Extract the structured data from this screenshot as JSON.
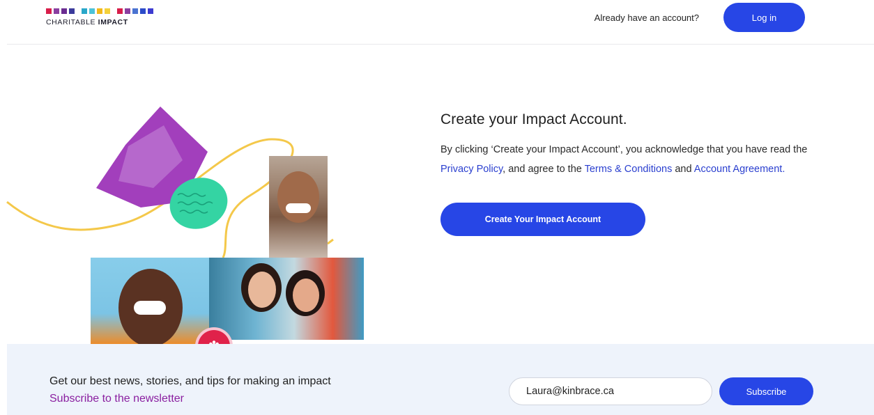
{
  "header": {
    "logo_text_plain": "CHARITABLE ",
    "logo_text_bold": "IMPACT",
    "logo_colors": [
      "#d81e4a",
      "#8a3fa0",
      "#6a2c91",
      "#3b3b9b",
      "#2aa7c9",
      "#4cc3d9",
      "#f2b81a",
      "#f4d13a",
      "#d81e4a",
      "#8a3fa0",
      "#4a73d1",
      "#2c4bc9",
      "#3d3bd0"
    ],
    "already_text": "Already have an account?",
    "login_label": "Log in"
  },
  "main": {
    "title": "Create your Impact Account.",
    "desc_part1": "By clicking ‘Create your Impact Account’, you acknowledge that you have read the ",
    "privacy_link": "Privacy Policy",
    "desc_part2": ", and agree to the ",
    "terms_link": "Terms & Conditions",
    "desc_part3": " and ",
    "agreement_link": "Account Agreement.",
    "create_label": "Create Your Impact Account"
  },
  "illustration": {
    "badge_icon": "maple-leaf-icon",
    "colors": {
      "purple": "#a23fbc",
      "green": "#34d4a3",
      "yellow": "#f4c84a"
    }
  },
  "newsletter": {
    "text": "Get our best news, stories, and tips for making an impact",
    "link": "Subscribe to the newsletter",
    "email_value": "Laura@kinbrace.ca",
    "subscribe_label": "Subscribe"
  },
  "colors": {
    "accent": "#2746e6",
    "link": "#2a3fcf",
    "newsletter_link": "#8a1fa0",
    "newsletter_bg": "#eef3fb"
  }
}
